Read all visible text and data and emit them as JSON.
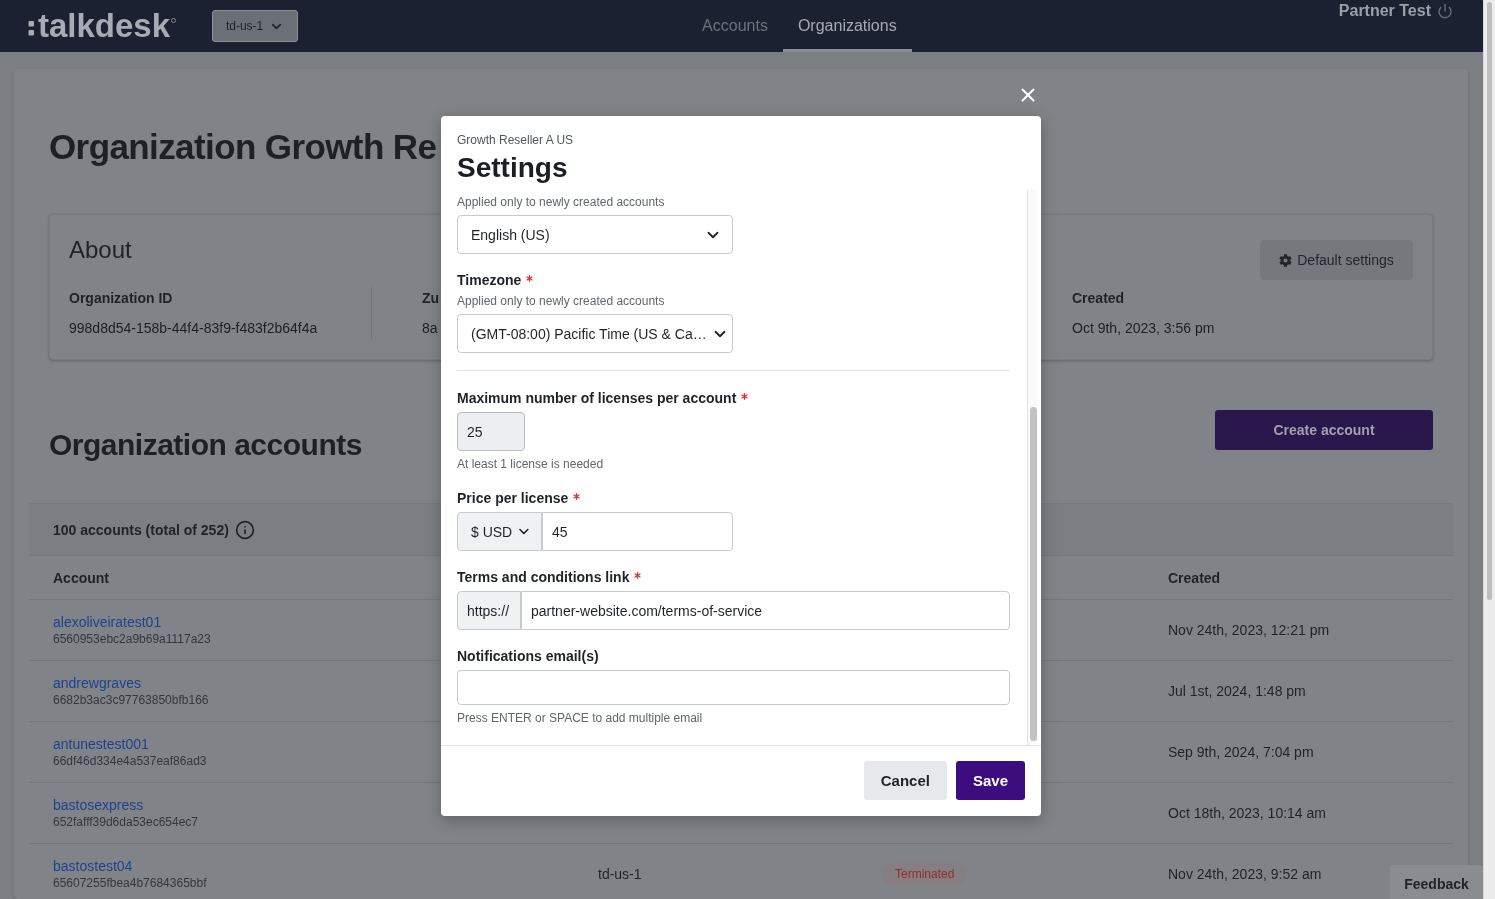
{
  "navbar": {
    "logo": "talkdesk",
    "region": "td-us-1",
    "tabs": [
      {
        "label": "Accounts",
        "selected": false
      },
      {
        "label": "Organizations",
        "selected": true
      }
    ],
    "user": "Partner Test"
  },
  "organization": {
    "title": "Organization Growth Re",
    "about": {
      "title": "About",
      "button": "Default settings",
      "fields": [
        {
          "label": "Organization ID",
          "value": "998d8d54-158b-44f4-83f9-f483f2b64f4a"
        },
        {
          "label": "Zu",
          "value": "8a"
        },
        {
          "label": "Created",
          "value": "Oct 9th, 2023, 3:56 pm"
        }
      ]
    },
    "accounts": {
      "title": "Organization accounts",
      "button": "Create account",
      "summary": "100 accounts (total of 252)",
      "columns": [
        "Account",
        "Created"
      ],
      "rows": [
        {
          "account": "alexoliveiratest01",
          "account_id": "6560953ebc2a9b69a1117a23",
          "created": "Nov 24th, 2023, 12:21 pm"
        },
        {
          "account": "andrewgraves",
          "account_id": "6682b3ac3c97763850bfb166",
          "created": "Jul 1st, 2024, 1:48 pm"
        },
        {
          "account": "antunestest001",
          "account_id": "66df46d334e4a537eaf86ad3",
          "created": "Sep 9th, 2024, 7:04 pm"
        },
        {
          "account": "bastosexpress",
          "account_id": "652fafff39d6da53ec654ec7",
          "created": "Oct 18th, 2023, 10:14 am"
        },
        {
          "account": "bastostest04",
          "account_id": "65607255fbea4b7684365bbf",
          "column_2": "td-us-1",
          "column_3": "Terminated",
          "created": "Nov 24th, 2023, 9:52 am"
        }
      ]
    }
  },
  "feedback": "Feedback",
  "modal": {
    "subtitle": "Growth Reseller A US",
    "title": "Settings",
    "sections": [
      {
        "fields": [
          {
            "kind": "select",
            "hint": "Applied only to newly created accounts",
            "value": "English (US)",
            "disabled": false
          },
          {
            "kind": "select",
            "label": "Timezone",
            "required": true,
            "hint": "Applied only to newly created accounts",
            "value": "(GMT-08:00) Pacific Time (US & Ca…",
            "disabled": false
          }
        ]
      },
      {
        "fields": [
          {
            "kind": "number",
            "label": "Maximum number of licenses per account",
            "required": true,
            "value": "25",
            "disabled": true,
            "helper": "At least 1 license is needed"
          },
          {
            "kind": "price",
            "label": "Price per license",
            "required": true,
            "currency": "$ USD",
            "value": "45",
            "disabled": false
          },
          {
            "kind": "url",
            "label": "Terms and conditions link",
            "required": true,
            "prefix": "https://",
            "value": "partner-website.com/terms-of-service",
            "disabled": false
          },
          {
            "kind": "email",
            "label": "Notifications email(s)",
            "required": false,
            "helper": "Press ENTER or SPACE to add multiple email",
            "disabled": false
          }
        ]
      }
    ],
    "buttons": [
      {
        "label": "Cancel",
        "kind": "secondary"
      },
      {
        "label": "Save",
        "kind": "primary"
      }
    ]
  }
}
